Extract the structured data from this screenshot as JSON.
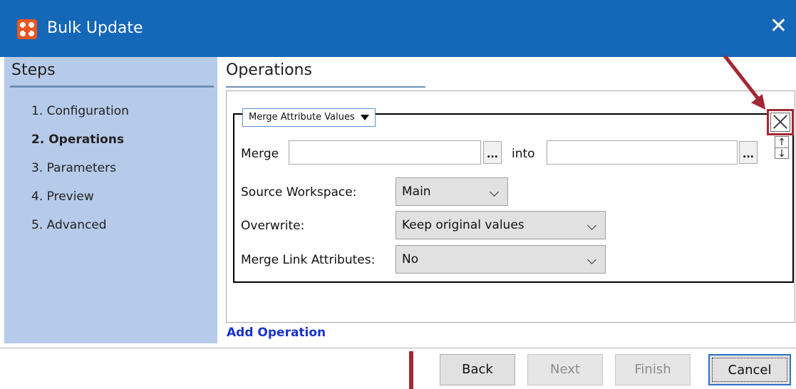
{
  "window": {
    "title": "Bulk Update",
    "close_glyph": "✕"
  },
  "steps_panel": {
    "heading": "Steps",
    "items": [
      {
        "label": "1. Configuration",
        "active": false
      },
      {
        "label": "2. Operations",
        "active": true
      },
      {
        "label": "3. Parameters",
        "active": false
      },
      {
        "label": "4. Preview",
        "active": false
      },
      {
        "label": "5. Advanced",
        "active": false
      }
    ]
  },
  "main": {
    "heading": "Operations",
    "operation": {
      "type_label": "Merge Attribute Values",
      "merge_label": "Merge",
      "merge_value": "",
      "into_label": "into",
      "into_value": "",
      "ellipsis": "...",
      "source_workspace_label": "Source Workspace:",
      "source_workspace_value": "Main",
      "overwrite_label": "Overwrite:",
      "overwrite_value": "Keep original values",
      "merge_link_label": "Merge Link Attributes:",
      "merge_link_value": "No",
      "move_up_glyph": "↑",
      "move_down_glyph": "↓"
    },
    "add_operation": "Add Operation"
  },
  "footer": {
    "back": "Back",
    "next": "Next",
    "finish": "Finish",
    "cancel": "Cancel"
  },
  "colors": {
    "title_bar": "#1567b8",
    "steps_panel": "#b6cbe9",
    "annotation": "#a32735",
    "link": "#1a33cc"
  }
}
